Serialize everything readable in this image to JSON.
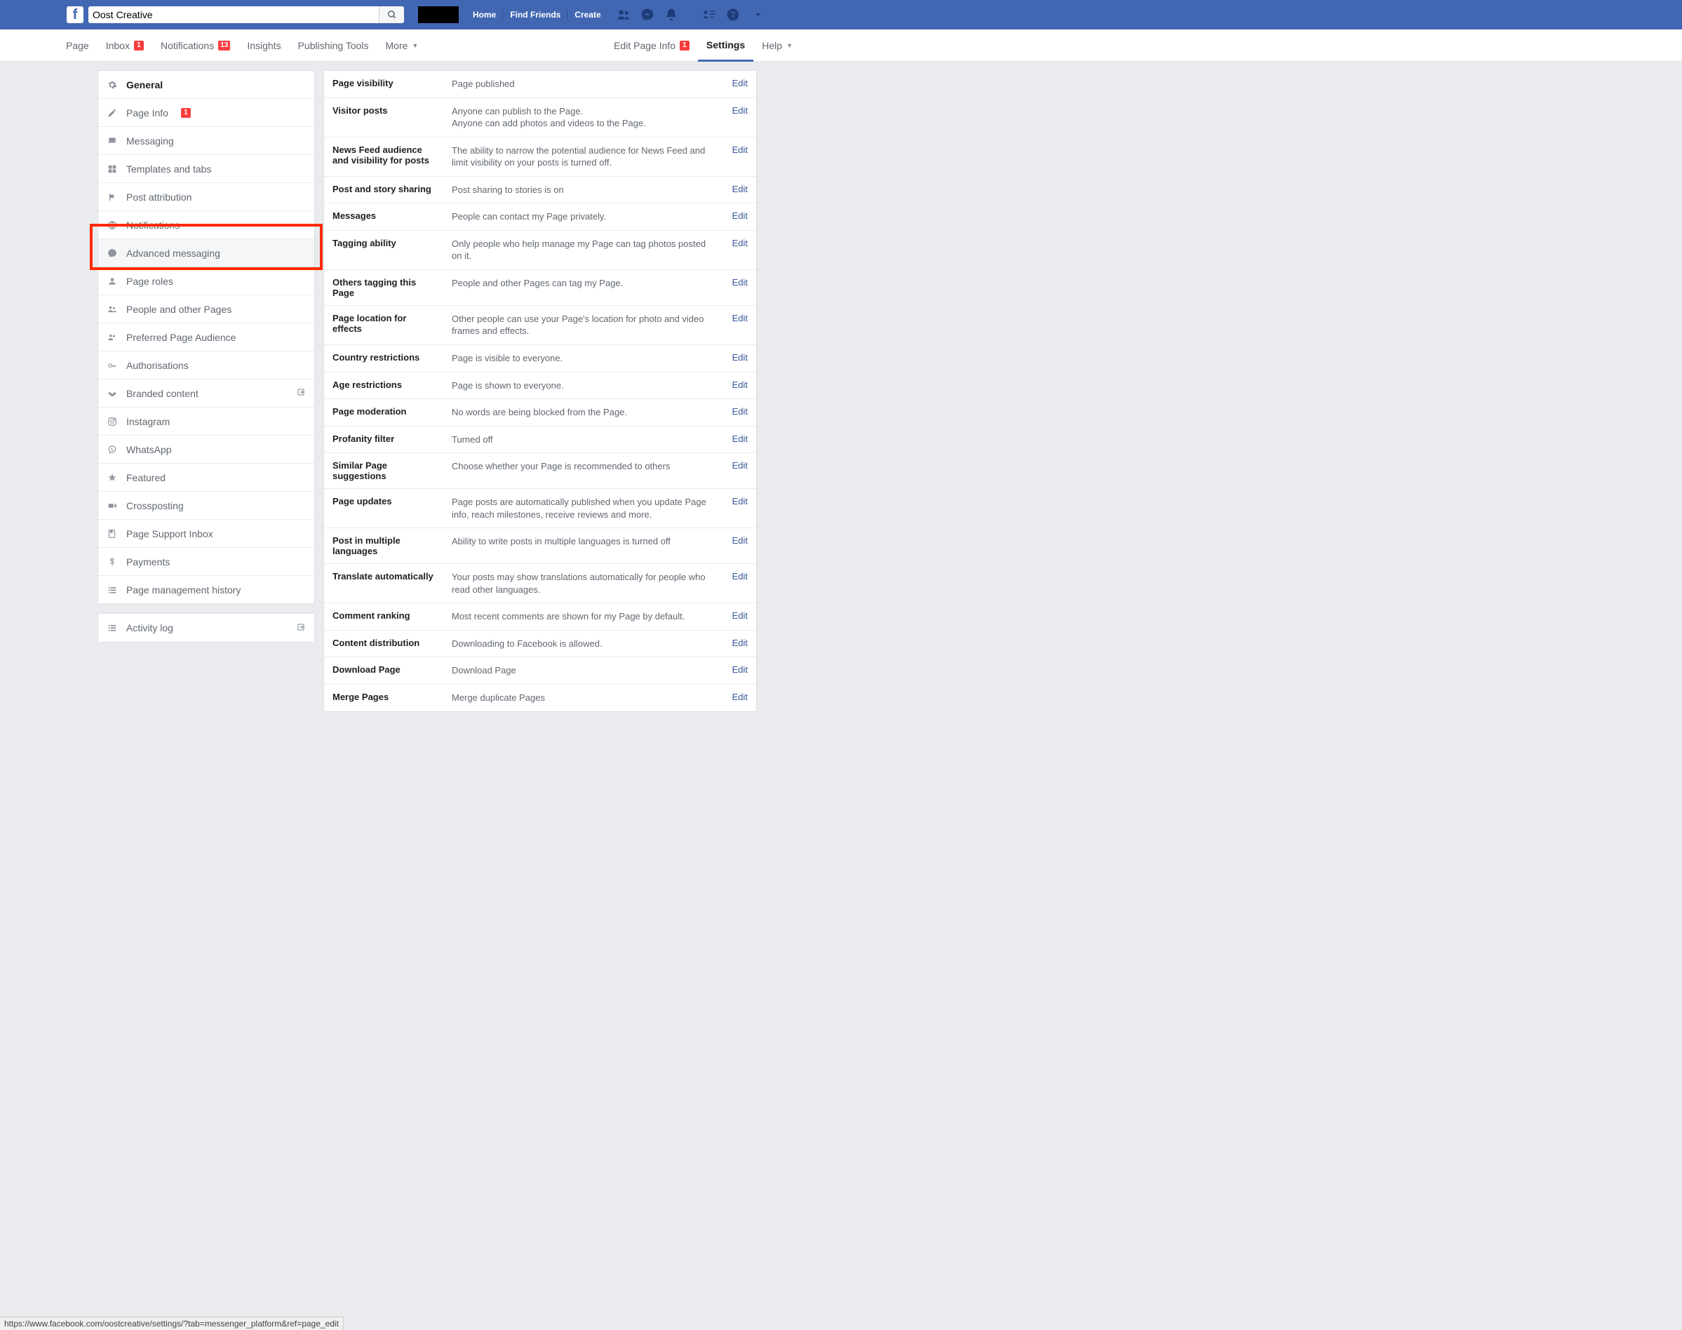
{
  "search": {
    "value": "Oost Creative"
  },
  "nav": {
    "links": [
      "Home",
      "Find Friends",
      "Create"
    ]
  },
  "subnav": {
    "page": "Page",
    "inbox": {
      "label": "Inbox",
      "badge": "1"
    },
    "notifications": {
      "label": "Notifications",
      "badge": "13"
    },
    "insights": "Insights",
    "publishing": "Publishing Tools",
    "more": "More",
    "editPage": {
      "label": "Edit Page Info",
      "badge": "1"
    },
    "settings": "Settings",
    "help": "Help"
  },
  "sidebar": {
    "items": [
      {
        "label": "General"
      },
      {
        "label": "Page Info",
        "badge": "1"
      },
      {
        "label": "Messaging"
      },
      {
        "label": "Templates and tabs"
      },
      {
        "label": "Post attribution"
      },
      {
        "label": "Notifications"
      },
      {
        "label": "Advanced messaging"
      },
      {
        "label": "Page roles"
      },
      {
        "label": "People and other Pages"
      },
      {
        "label": "Preferred Page Audience"
      },
      {
        "label": "Authorisations"
      },
      {
        "label": "Branded content"
      },
      {
        "label": "Instagram"
      },
      {
        "label": "WhatsApp"
      },
      {
        "label": "Featured"
      },
      {
        "label": "Crossposting"
      },
      {
        "label": "Page Support Inbox"
      },
      {
        "label": "Payments"
      },
      {
        "label": "Page management history"
      }
    ],
    "activity": "Activity log"
  },
  "settings": {
    "editLabel": "Edit",
    "rows": [
      {
        "label": "Page visibility",
        "desc": "Page published"
      },
      {
        "label": "Visitor posts",
        "desc": "Anyone can publish to the Page.\nAnyone can add photos and videos to the Page."
      },
      {
        "label": "News Feed audience and visibility for posts",
        "desc": "The ability to narrow the potential audience for News Feed and limit visibility on your posts is turned off."
      },
      {
        "label": "Post and story sharing",
        "desc": "Post sharing to stories is on"
      },
      {
        "label": "Messages",
        "desc": "People can contact my Page privately."
      },
      {
        "label": "Tagging ability",
        "desc": "Only people who help manage my Page can tag photos posted on it."
      },
      {
        "label": "Others tagging this Page",
        "desc": "People and other Pages can tag my Page."
      },
      {
        "label": "Page location for effects",
        "desc": "Other people can use your Page's location for photo and video frames and effects."
      },
      {
        "label": "Country restrictions",
        "desc": "Page is visible to everyone."
      },
      {
        "label": "Age restrictions",
        "desc": "Page is shown to everyone."
      },
      {
        "label": "Page moderation",
        "desc": "No words are being blocked from the Page."
      },
      {
        "label": "Profanity filter",
        "desc": "Turned off"
      },
      {
        "label": "Similar Page suggestions",
        "desc": "Choose whether your Page is recommended to others"
      },
      {
        "label": "Page updates",
        "desc": "Page posts are automatically published when you update Page info, reach milestones, receive reviews and more."
      },
      {
        "label": "Post in multiple languages",
        "desc": "Ability to write posts in multiple languages is turned off"
      },
      {
        "label": "Translate automatically",
        "desc": "Your posts may show translations automatically for people who read other languages."
      },
      {
        "label": "Comment ranking",
        "desc": "Most recent comments are shown for my Page by default."
      },
      {
        "label": "Content distribution",
        "desc": "Downloading to Facebook is allowed."
      },
      {
        "label": "Download Page",
        "desc": "Download Page"
      },
      {
        "label": "Merge Pages",
        "desc": "Merge duplicate Pages"
      }
    ]
  },
  "statusUrl": "https://www.facebook.com/oostcreative/settings/?tab=messenger_platform&ref=page_edit"
}
